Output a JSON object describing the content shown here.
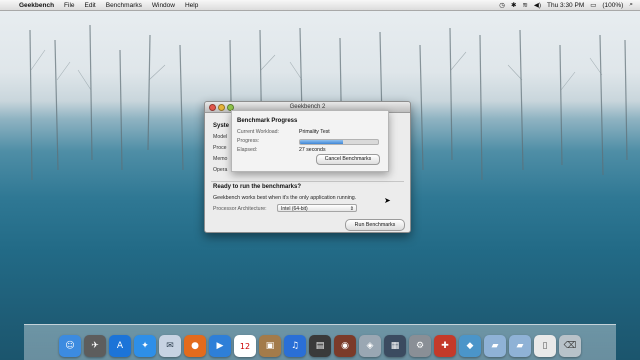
{
  "menubar": {
    "app": "Geekbench",
    "items": [
      "File",
      "Edit",
      "Benchmarks",
      "Window",
      "Help"
    ],
    "clock": "Thu 3:30 PM",
    "battery": "(100%)"
  },
  "window": {
    "title": "Geekbench 2",
    "system_header": "Syste",
    "sys_rows": [
      "Model",
      "Proce",
      "Memo",
      "Opera"
    ],
    "ready_title": "Ready to run the benchmarks?",
    "ready_text": "Geekbench works best when it's the only application running.",
    "arch_label": "Processor Architecture:",
    "arch_value": "Intel (64-bit)",
    "run_button": "Run Benchmarks"
  },
  "sheet": {
    "title": "Benchmark Progress",
    "workload_label": "Current Workload:",
    "workload_value": "Primality Test",
    "progress_label": "Progress:",
    "progress_fraction": 0.55,
    "elapsed_label": "Elapsed:",
    "elapsed_value": "27 seconds",
    "cancel_button": "Cancel Benchmarks"
  },
  "dock": {
    "icons": [
      "finder-icon",
      "utilities-icon",
      "app-store-icon",
      "safari-icon",
      "mail-icon",
      "firefox-icon",
      "facetime-icon",
      "calendar-icon",
      "photos-icon",
      "itunes-icon",
      "movie-icon",
      "photo-booth-icon",
      "preview-icon",
      "mission-control-icon",
      "system-prefs-icon",
      "tools-icon",
      "app-icon",
      "folder-icon",
      "folder-icon-2",
      "document-icon",
      "trash-icon"
    ],
    "calendar_day": "12"
  }
}
